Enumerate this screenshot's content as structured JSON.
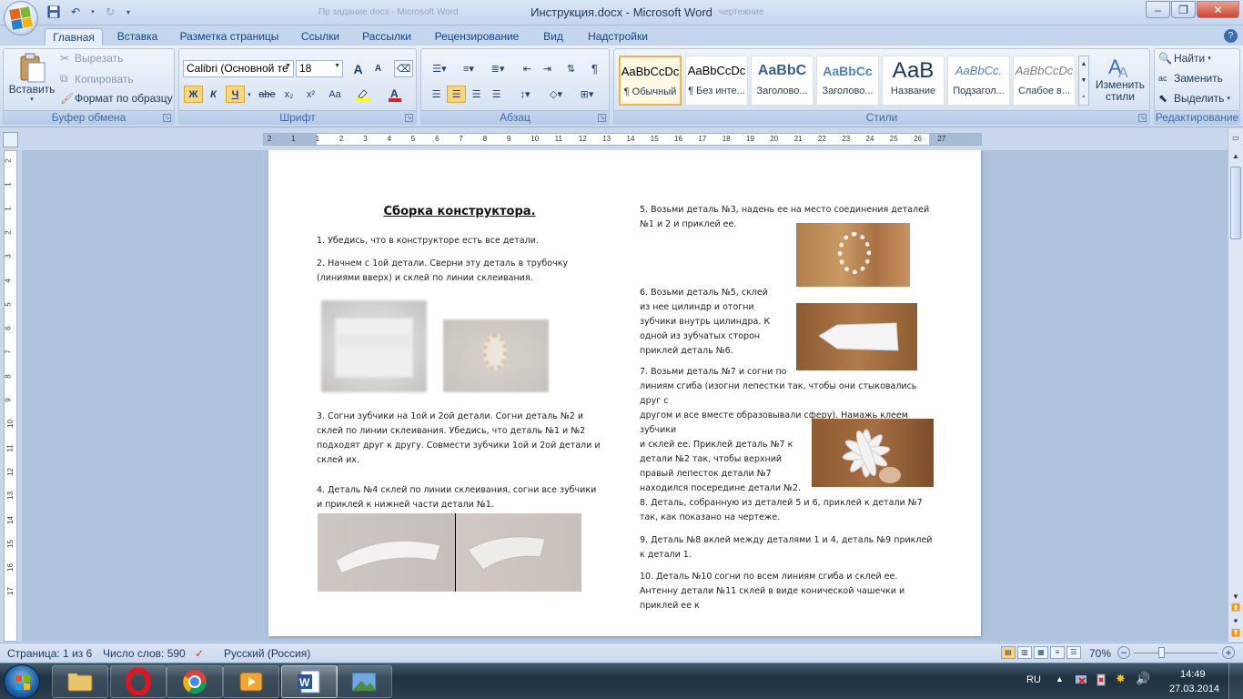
{
  "window": {
    "title": "Инструкция.docx - Microsoft Word",
    "ghost_left": "Пр задание.docx - Microsoft Word",
    "ghost_right": "чертежние"
  },
  "tabs": [
    "Главная",
    "Вставка",
    "Разметка страницы",
    "Ссылки",
    "Рассылки",
    "Рецензирование",
    "Вид",
    "Надстройки"
  ],
  "ribbon": {
    "clipboard": {
      "paste": "Вставить",
      "cut": "Вырезать",
      "copy": "Копировать",
      "format_painter": "Формат по образцу",
      "label": "Буфер обмена"
    },
    "font": {
      "name": "Calibri (Основной те",
      "size": "18",
      "bold": "Ж",
      "italic": "К",
      "underline": "Ч",
      "strike": "abe",
      "sub": "x₂",
      "sup": "x²",
      "case": "Aa",
      "grow": "A",
      "shrink": "A",
      "label": "Шрифт"
    },
    "paragraph": {
      "label": "Абзац",
      "pilcrow": "¶"
    },
    "styles": {
      "items": [
        {
          "sample": "AaBbCcDc",
          "name": "¶ Обычный"
        },
        {
          "sample": "AaBbCcDc",
          "name": "¶ Без инте..."
        },
        {
          "sample": "AaBbC",
          "name": "Заголово..."
        },
        {
          "sample": "AaBbCc",
          "name": "Заголово..."
        },
        {
          "sample": "АаВ",
          "name": "Название"
        },
        {
          "sample": "AaBbCc.",
          "name": "Подзагол..."
        },
        {
          "sample": "AaBbCcDc",
          "name": "Слабое в..."
        }
      ],
      "change": "Изменить стили",
      "label": "Стили"
    },
    "editing": {
      "find": "Найти",
      "replace": "Заменить",
      "select": "Выделить",
      "label": "Редактирование"
    }
  },
  "ruler": {
    "h_ticks": [
      "2",
      "1",
      "1",
      "2",
      "3",
      "4",
      "5",
      "6",
      "7",
      "8",
      "9",
      "10",
      "11",
      "12",
      "13",
      "14",
      "15",
      "16",
      "17",
      "18",
      "19",
      "20",
      "21",
      "22",
      "23",
      "24",
      "25",
      "26",
      "27"
    ],
    "v_ticks": [
      "2",
      "1",
      "1",
      "2",
      "3",
      "4",
      "5",
      "6",
      "7",
      "8",
      "9",
      "10",
      "11",
      "12",
      "13",
      "14",
      "15",
      "16",
      "17"
    ]
  },
  "document": {
    "heading": "Сборка конструктора.",
    "left": [
      "1. Убедись, что в конструкторе есть все детали.",
      "2. Начнем с 1ой детали. Сверни эту деталь в трубочку (линиями вверх) и склей по линии склеивания.",
      "3. Согни зубчики на 1ой и 2ой детали. Согни деталь №2 и склей по линии склеивания. Убедись, что деталь №1 и №2 подходят друг к другу. Совмести зубчики 1ой и 2ой детали и склей их.",
      "4. Деталь №4 склей по линии склеивания, согни все зубчики и приклей к нижней части детали №1."
    ],
    "right": [
      "5. Возьми деталь №3, надень ее на место соединения деталей №1 и 2 и приклей ее.",
      "6. Возьми деталь №5, склей из нее цилиндр и отогни зубчики внутрь цилиндра. К одной из зубчатых сторон приклей деталь №6.",
      "7. Возьми деталь №7 и согни по линиям сгиба (изогни лепестки так, чтобы они стыковались друг с другом и все вместе образовывали сферу). Намажь клеем зубчики и склей ее. Приклей деталь №7 к детали №2 так, чтобы верхний правый лепесток детали №7 находился посередине детали №2.",
      "8. Деталь, собранную из деталей 5 и 6, приклей к детали №7 так, как показано на чертеже.",
      "9. Деталь №8 вклей между деталями 1 и 4, деталь №9 приклей к детали 1.",
      "10. Деталь №10 согни по всем линиям сгиба и склей ее. Антенну детали №11 склей в виде конической чашечки и приклей ее к"
    ],
    "p7_lines": [
      "7. Возьми деталь №7 и согни по",
      "линиям сгиба (изогни лепестки так, чтобы они стыковались друг с",
      "другом и все вместе образовывали сферу). Намажь клеем зубчики",
      "и склей ее. Приклей деталь №7 к",
      "детали №2 так, чтобы верхний",
      "правый лепесток детали №7",
      "находился посередине детали №2."
    ]
  },
  "status": {
    "page": "Страница: 1 из 6",
    "words": "Число слов: 590",
    "lang": "Русский (Россия)",
    "zoom": "70%"
  },
  "taskbar": {
    "lang": "RU",
    "time": "14:49",
    "date": "27.03.2014"
  },
  "icons": [
    "office-logo",
    "save-icon",
    "undo-icon",
    "redo-icon",
    "paste-icon",
    "scissors-icon",
    "copy-icon",
    "brush-icon",
    "find-icon",
    "replace-icon",
    "select-icon"
  ]
}
